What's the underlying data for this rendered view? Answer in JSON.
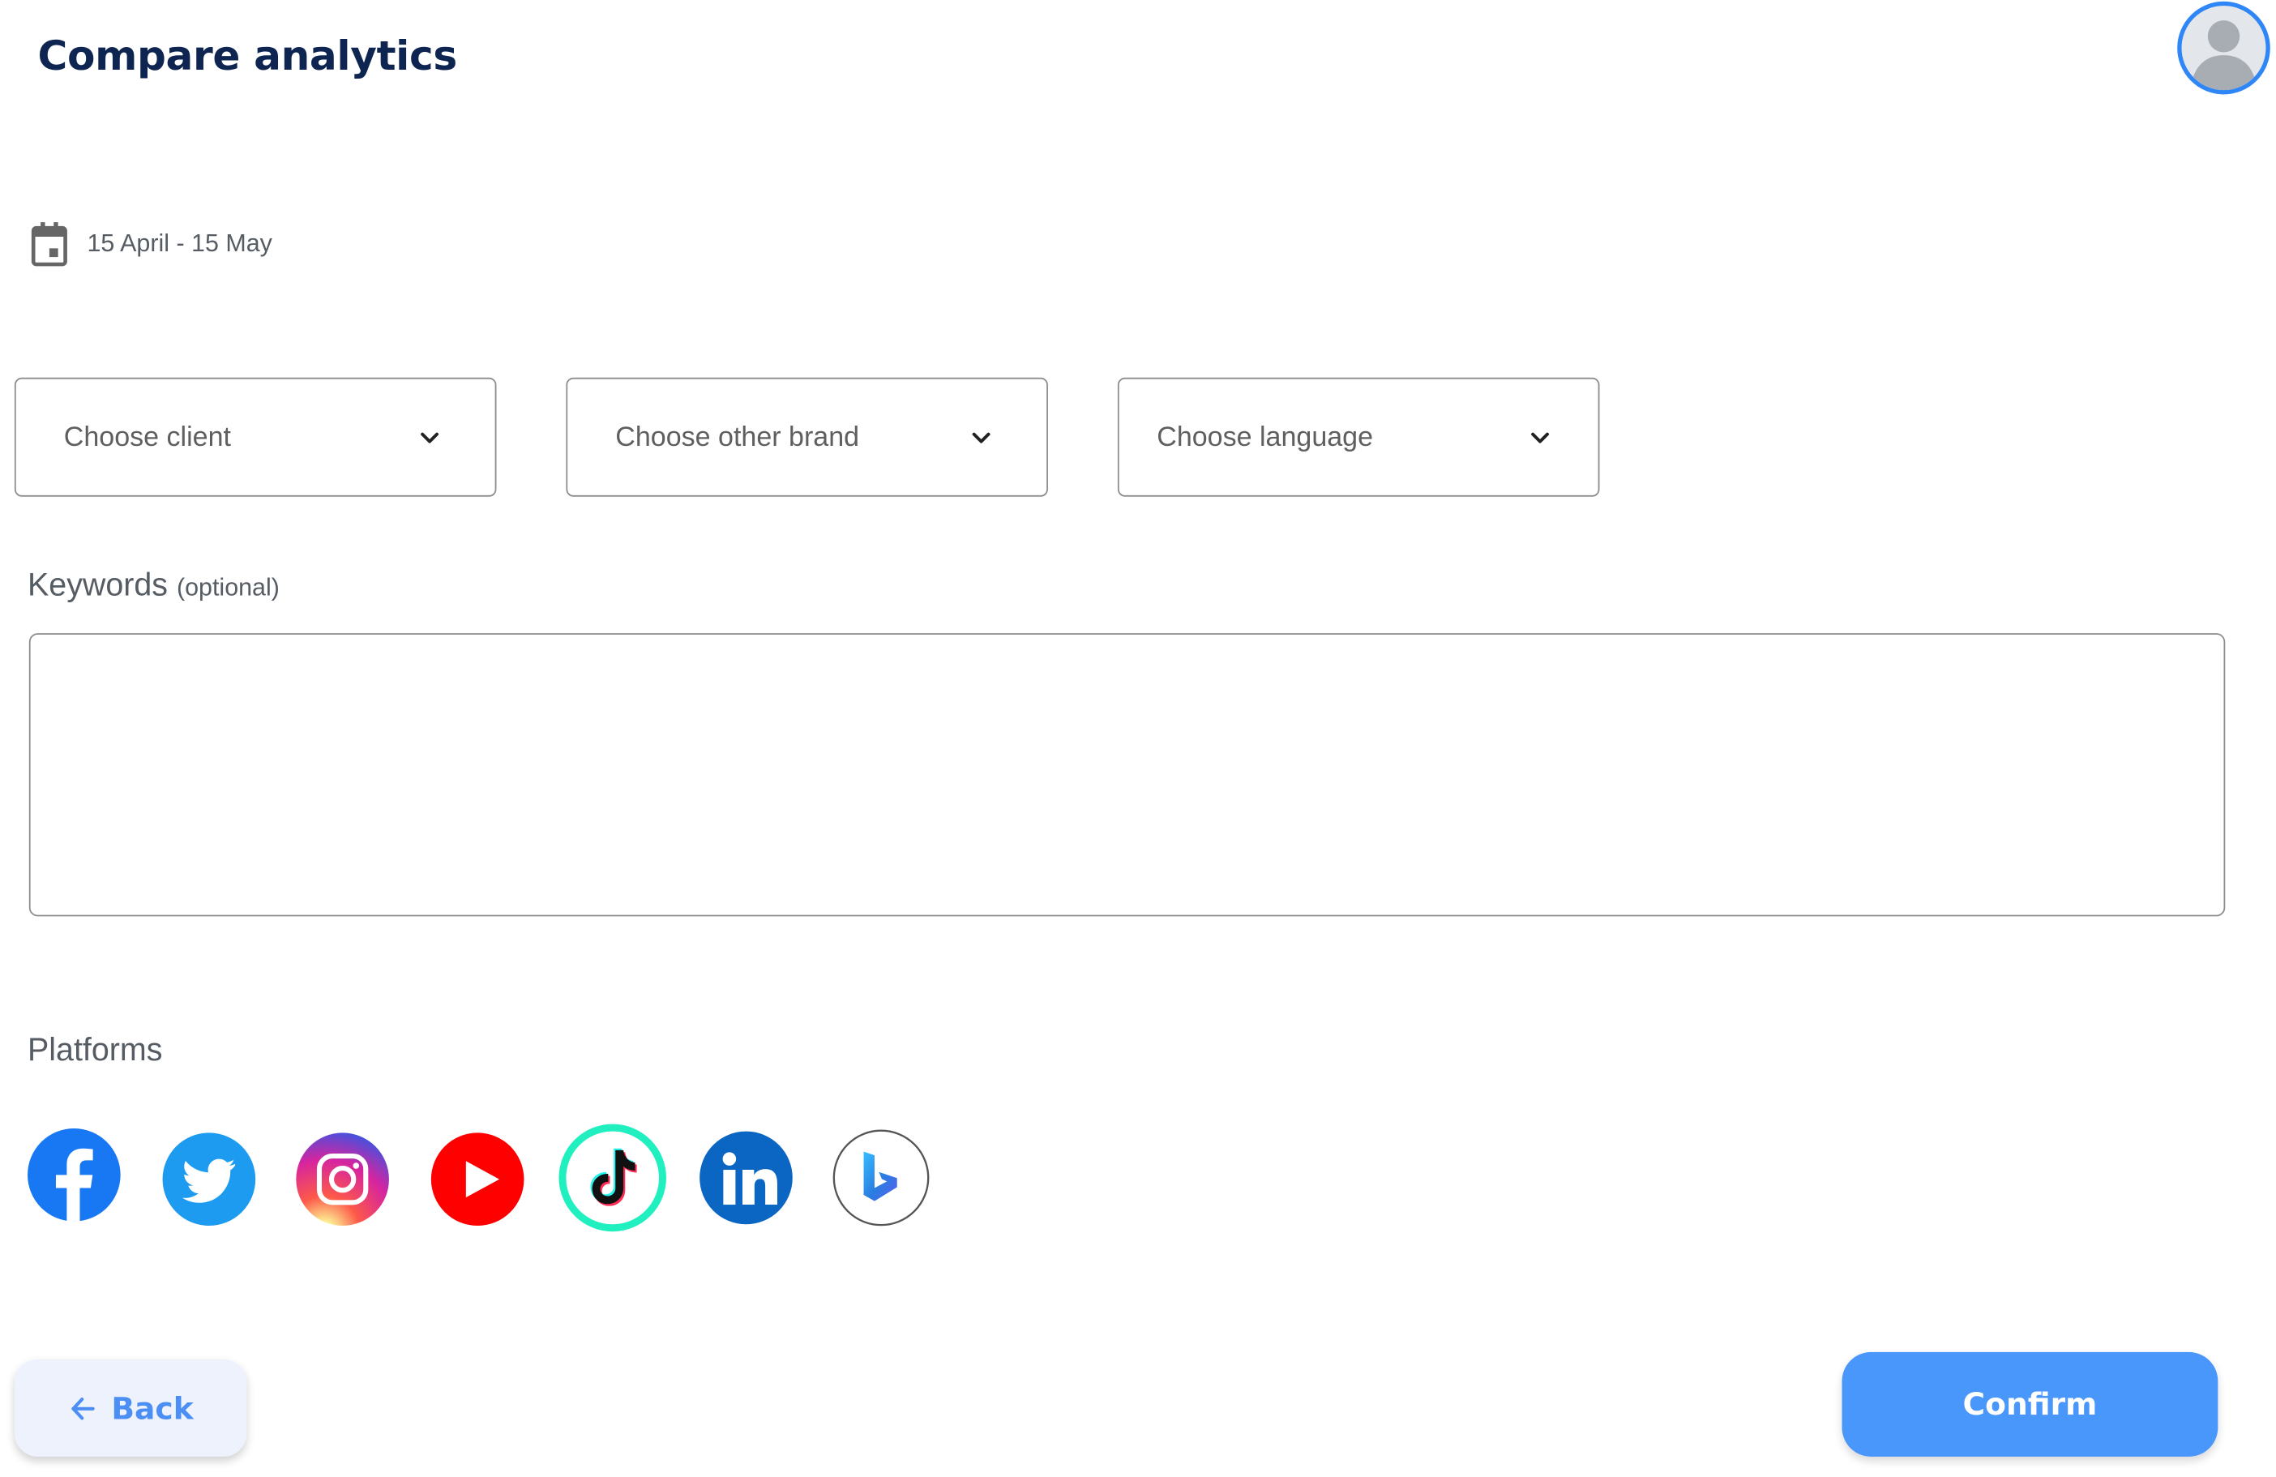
{
  "header": {
    "title": "Compare analytics",
    "avatar_icon": "user-avatar-icon"
  },
  "date_range": {
    "icon": "calendar-icon",
    "text": "15 April - 15 May"
  },
  "filters": {
    "client": {
      "placeholder": "Choose client",
      "icon": "chevron-down-icon"
    },
    "brand": {
      "placeholder": "Choose other brand",
      "icon": "chevron-down-icon"
    },
    "language": {
      "placeholder": "Choose language",
      "icon": "chevron-down-icon"
    }
  },
  "keywords": {
    "label": "Keywords",
    "optional": "(optional)",
    "value": ""
  },
  "platforms": {
    "label": "Platforms",
    "items": [
      {
        "name": "Facebook",
        "icon": "facebook-icon",
        "color": "#1877f2"
      },
      {
        "name": "Twitter",
        "icon": "twitter-icon",
        "color": "#1d9bf0"
      },
      {
        "name": "Instagram",
        "icon": "instagram-icon",
        "color": "#d6249f"
      },
      {
        "name": "YouTube",
        "icon": "youtube-icon",
        "color": "#ff0000"
      },
      {
        "name": "TikTok",
        "icon": "tiktok-icon",
        "color": "#20f0c0"
      },
      {
        "name": "LinkedIn",
        "icon": "linkedin-icon",
        "color": "#0a66c2"
      },
      {
        "name": "Bing",
        "icon": "bing-icon",
        "color": "#2a7de1"
      }
    ]
  },
  "footer": {
    "back_label": "Back",
    "confirm_label": "Confirm"
  },
  "colors": {
    "title": "#0e2552",
    "primary": "#4a97fb",
    "back_bg": "#edf2fd",
    "border": "#8d8d8d"
  }
}
